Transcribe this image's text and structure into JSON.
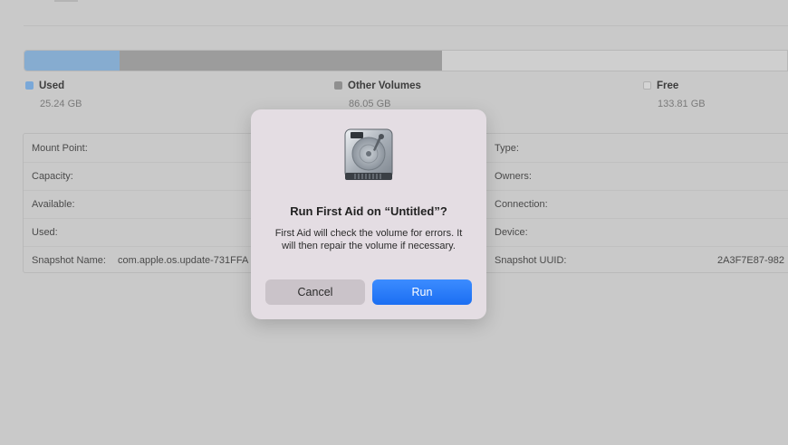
{
  "usage": {
    "legend": [
      {
        "name": "Used",
        "size": "25.24 GB",
        "color": "#6fa2d6"
      },
      {
        "name": "Other Volumes",
        "size": "86.05 GB",
        "color": "#8f8f8f"
      },
      {
        "name": "Free",
        "size": "133.81 GB",
        "color": "#d6d6d6"
      }
    ]
  },
  "info": {
    "mount_point_label": "Mount Point:",
    "capacity_label": "Capacity:",
    "available_label": "Available:",
    "used_label": "Used:",
    "snapshot_name_label": "Snapshot Name:",
    "snapshot_name_value": "com.apple.os.update-731FFA",
    "type_label": "Type:",
    "owners_label": "Owners:",
    "connection_label": "Connection:",
    "device_label": "Device:",
    "snapshot_uuid_label": "Snapshot UUID:",
    "snapshot_uuid_value": "2A3F7E87-982"
  },
  "dialog": {
    "title": "Run First Aid on “Untitled”?",
    "message": "First Aid will check the volume for errors. It will then repair the volume if necessary.",
    "cancel_label": "Cancel",
    "run_label": "Run",
    "icon": "hard-drive-icon",
    "accent": "#2a7cf7"
  }
}
